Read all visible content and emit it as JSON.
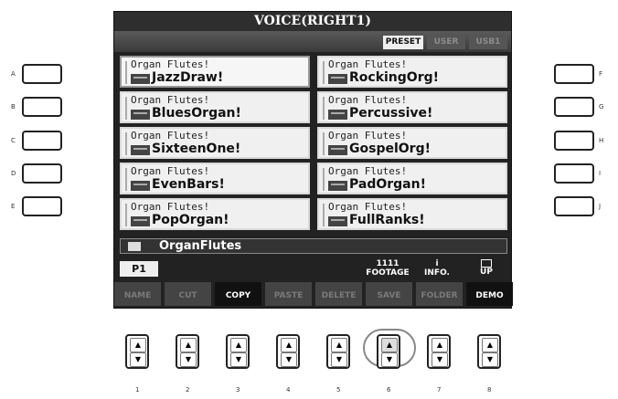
{
  "screen": {
    "title": "VOICE(RIGHT1)",
    "tabs": [
      {
        "label": "PRESET",
        "active": true
      },
      {
        "label": "USER",
        "active": false
      },
      {
        "label": "USB1",
        "active": false
      }
    ],
    "voices": [
      {
        "category": "Organ Flutes!",
        "name": "JazzDraw!",
        "selected": true
      },
      {
        "category": "Organ Flutes!",
        "name": "RockingOrg!",
        "selected": false
      },
      {
        "category": "Organ Flutes!",
        "name": "BluesOrgan!",
        "selected": false
      },
      {
        "category": "Organ Flutes!",
        "name": "Percussive!",
        "selected": false
      },
      {
        "category": "Organ Flutes!",
        "name": "SixteenOne!",
        "selected": false
      },
      {
        "category": "Organ Flutes!",
        "name": "GospelOrg!",
        "selected": false
      },
      {
        "category": "Organ Flutes!",
        "name": "EvenBars!",
        "selected": false
      },
      {
        "category": "Organ Flutes!",
        "name": "PadOrgan!",
        "selected": false
      },
      {
        "category": "Organ Flutes!",
        "name": "PopOrgan!",
        "selected": false
      },
      {
        "category": "Organ Flutes!",
        "name": "FullRanks!",
        "selected": false
      }
    ],
    "folder_path": "OrganFlutes",
    "page": "P1",
    "top_functions": {
      "footage_line1": "1111",
      "footage_line2": "FOOTAGE",
      "info_line1": "i",
      "info_line2": "INFO.",
      "up": "UP"
    },
    "bottom_functions": [
      {
        "label": "NAME",
        "enabled": false
      },
      {
        "label": "CUT",
        "enabled": false
      },
      {
        "label": "COPY",
        "enabled": true
      },
      {
        "label": "PASTE",
        "enabled": false
      },
      {
        "label": "DELETE",
        "enabled": false
      },
      {
        "label": "SAVE",
        "enabled": false
      },
      {
        "label": "FOLDER",
        "enabled": false
      },
      {
        "label": "DEMO",
        "enabled": true
      }
    ]
  },
  "left_buttons": [
    "A",
    "B",
    "C",
    "D",
    "E"
  ],
  "right_buttons": [
    "F",
    "G",
    "H",
    "I",
    "J"
  ],
  "bottom_buttons": [
    "1",
    "2",
    "3",
    "4",
    "5",
    "6",
    "7",
    "8"
  ],
  "up_symbol": "▲",
  "down_symbol": "▼",
  "highlighted_button": "6"
}
